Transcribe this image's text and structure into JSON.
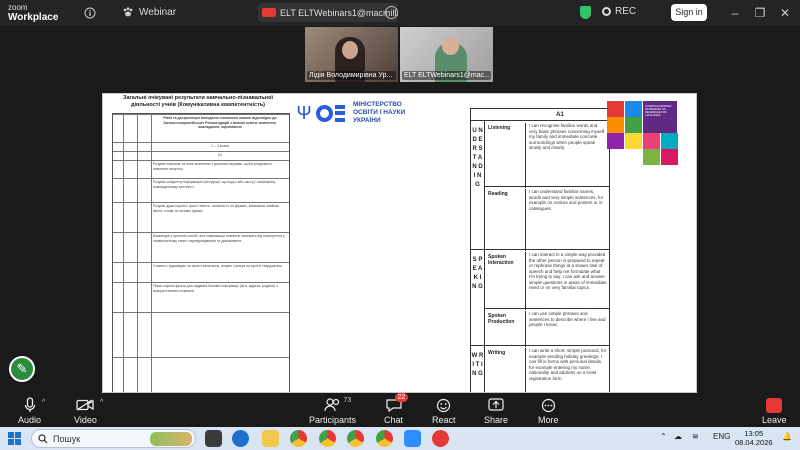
{
  "app": {
    "logo_line1": "zoom",
    "logo_line2": "Workplace",
    "mode_label": "Webinar",
    "meeting_title": "ELT ELTWebinars1@macmillan",
    "more_glyph": "···",
    "rec_label": "REC",
    "signin_label": "Sign in"
  },
  "window_controls": {
    "minimize": "–",
    "restore": "❐",
    "close": "✕"
  },
  "videos": [
    {
      "name": "Лідія Володимирівна Ур..."
    },
    {
      "name": "ELT ELTWebinars1@mac..."
    }
  ],
  "shared_doc": {
    "left_heading": "Загальні очікувані результати навчально-пізнавальної діяльності учнів (Комунікативна компетентність)",
    "left_rows": [
      "Рівні та дескриптори володіння іноземною мовою відповідно до Загальноєвропейських Рекомендацій з мовної освіти: вивчення, викладання, оцінювання",
      "1 – 4 класи",
      "A1",
      "Розуміє повільне та чітке мовлення з довгими паузами, щоби усвідомити значення почутого.",
      "Розуміє конкретну інформацію (інструкції, що поруч або часту) і знайомому повсякденному контексті.",
      "Розуміє дуже короткі, прості тексти, читаючи їх по фразах, впізнаючи знайомі імена, слова та основні фрази.",
      "Взаємодіє у простий спосіб, але комунікація повністю залежить від повторення у сповільненому темпі, перефразування та домовляння.",
      "Ставить і відповідає на прості запитання, ініціює і реагує на прості твердження.",
      "Пише короткі фрази для надання базової інформації (ім'я, адреса, родина) з використанням словника."
    ],
    "ministry_line1": "МІНІСТЕРСТВО",
    "ministry_line2": "ОСВІТИ І НАУКИ",
    "ministry_line3": "УКРАЇНИ",
    "trident_glyph": "Ψ",
    "right_header": "A1",
    "right_side_1": "U N D E R S T A N D I N G",
    "right_side_2": "S P E A K I N G",
    "right_side_3": "W R I T I N G",
    "skills": [
      {
        "label": "Listening",
        "text": "I can recognise familiar words and very basic phrases concerning myself, my family and immediate concrete surroundings when people speak slowly and clearly."
      },
      {
        "label": "Reading",
        "text": "I can understand familiar names, words and very simple sentences, for example on notices and posters or in catalogues."
      },
      {
        "label": "Spoken Interaction",
        "text": "I can interact in a simple way provided the other person is prepared to repeat or rephrase things at a slower rate of speech and help me formulate what I'm trying to say. I can ask and answer simple questions in areas of immediate need or on very familiar topics."
      },
      {
        "label": "Spoken Production",
        "text": "I can use simple phrases and sentences to describe where I live and people I know."
      },
      {
        "label": "Writing",
        "text": "I can write a short, simple postcard, for example sending holiday greetings. I can fill in forms with personal details, for example entering my name, nationality and address on a hotel registration form."
      }
    ],
    "corner_logo_text": "COMMON EUROPEAN FRAMEWORK OF REFERENCE FOR LANGUAGES"
  },
  "toolbar": {
    "audio": "Audio",
    "video": "Video",
    "participants": "Participants",
    "participants_count": "73",
    "chat": "Chat",
    "chat_badge": "22",
    "react": "React",
    "share": "Share",
    "more": "More",
    "leave": "Leave"
  },
  "taskbar": {
    "search_placeholder": "Пошук",
    "lang": "ENG",
    "time": "13:05",
    "date": "08.04.2026"
  },
  "colors": {
    "accent_green": "#2d8c3c",
    "leave_red": "#e53935",
    "ministry_blue": "#2a5cdb"
  }
}
